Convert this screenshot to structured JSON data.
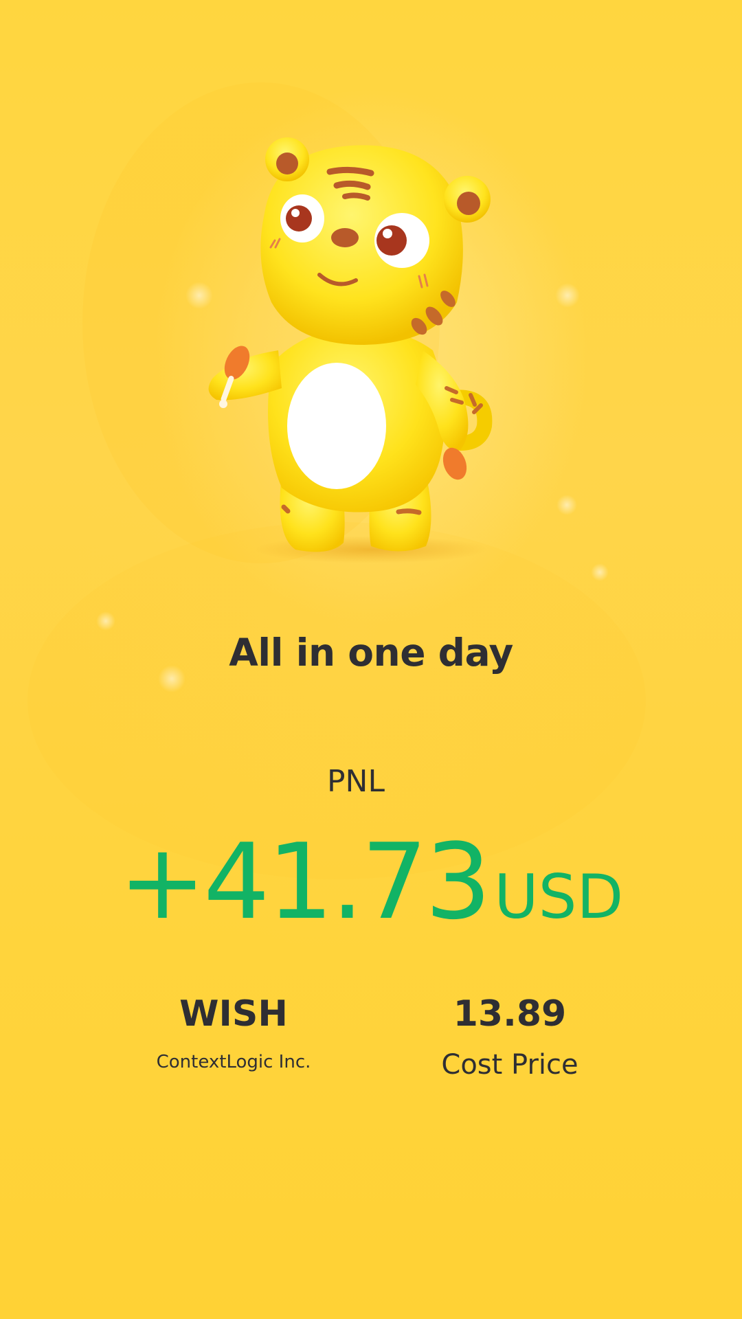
{
  "headline": "All in one day",
  "pnl": {
    "label": "PNL",
    "value": "+41.73",
    "unit": "USD",
    "color": "#12B365"
  },
  "stock": {
    "ticker": "WISH",
    "company": "ContextLogic Inc."
  },
  "cost": {
    "value": "13.89",
    "label": "Cost Price"
  },
  "colors": {
    "background": "#FFD23A",
    "text": "#2E2E33"
  },
  "mascot": {
    "icon": "tiger-mascot-icon"
  }
}
